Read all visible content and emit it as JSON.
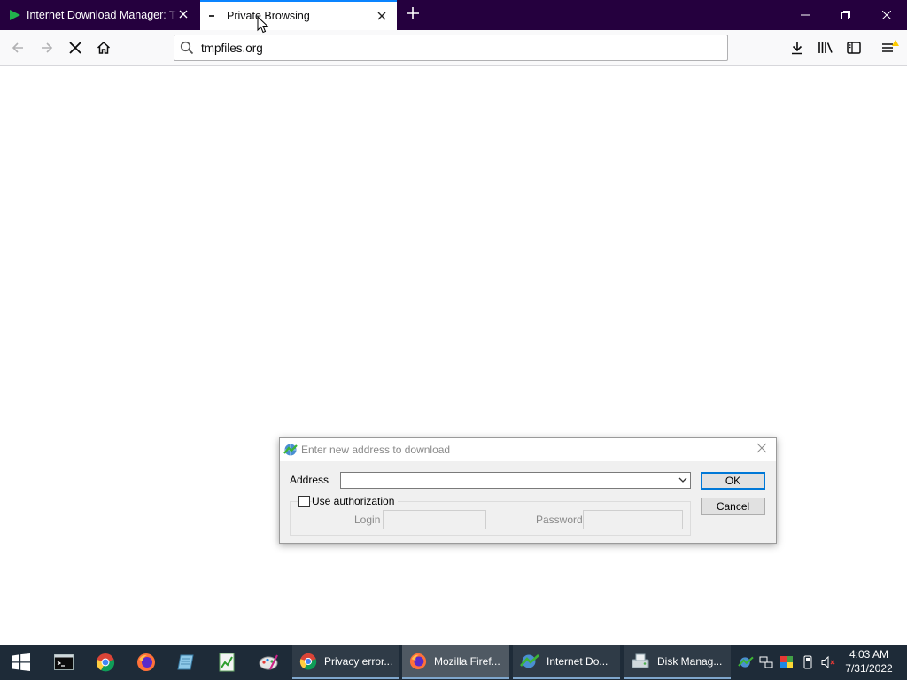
{
  "browser": {
    "tabs": [
      {
        "title": "Internet Download Manager: Th",
        "icon": "idm-arrow-icon",
        "active": false
      },
      {
        "title": "Private Browsing",
        "icon": "private-dot-icon",
        "active": true
      }
    ],
    "url": "tmpfiles.org"
  },
  "dialog": {
    "title": "Enter new address to download",
    "address_label": "Address",
    "address_value": "",
    "use_auth_label": "Use authorization",
    "login_label": "Login",
    "password_label": "Password",
    "ok_label": "OK",
    "cancel_label": "Cancel"
  },
  "taskbar": {
    "apps": [
      {
        "title": "Privacy error...",
        "icon": "chrome-icon"
      },
      {
        "title": "Mozilla Firef...",
        "icon": "firefox-icon",
        "active": true
      },
      {
        "title": "Internet Do...",
        "icon": "idm-icon"
      },
      {
        "title": "Disk Manag...",
        "icon": "disk-management-icon"
      }
    ],
    "clock": {
      "time": "4:03 AM",
      "date": "7/31/2022"
    }
  },
  "colors": {
    "tabstrip": "#25003e",
    "accent": "#0a84ff",
    "taskbar": "#1e2b38"
  }
}
